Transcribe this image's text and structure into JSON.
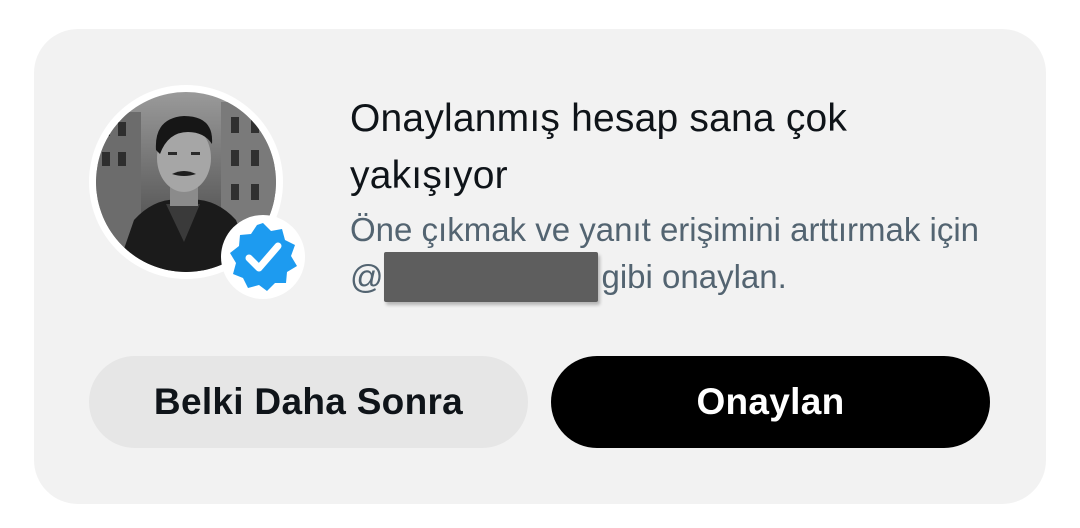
{
  "prompt": {
    "title": "Onaylanmış hesap sana çok yakışıyor",
    "description_before": "Öne çıkmak ve yanıt erişimini arttırmak için @",
    "description_after": "gibi onaylan.",
    "avatar_icon": "profile-avatar",
    "badge_icon": "verified-checkmark-icon",
    "badge_color": "#1d9bf0"
  },
  "buttons": {
    "later_label": "Belki Daha Sonra",
    "verify_label": "Onaylan"
  },
  "colors": {
    "card_background": "#f2f2f2",
    "primary_button": "#000000",
    "secondary_button": "#e6e6e6",
    "title_text": "#0f1419",
    "body_text": "#536471"
  }
}
